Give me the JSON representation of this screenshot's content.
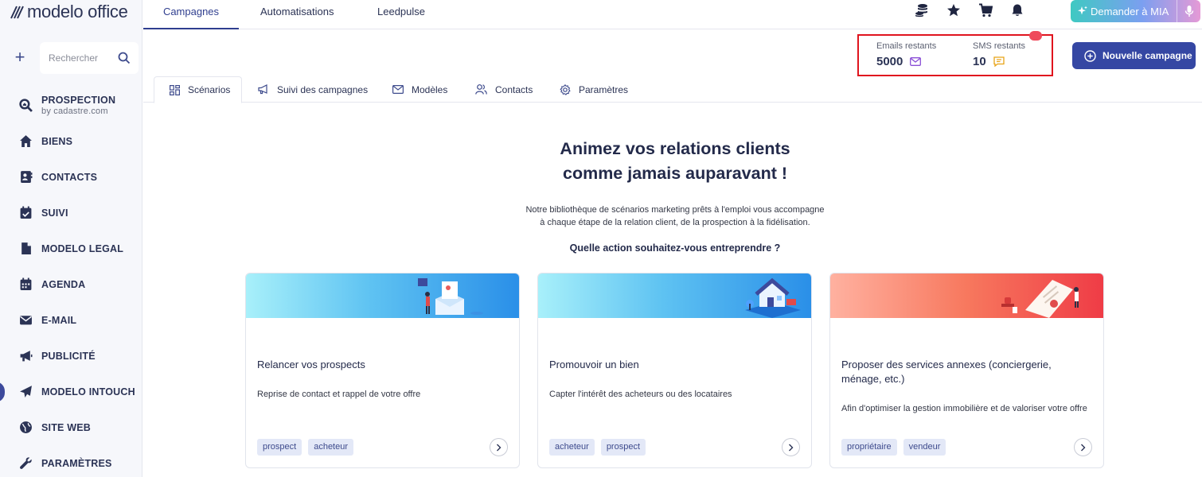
{
  "brand": {
    "logo_text": "modelo office"
  },
  "sidebar": {
    "search_placeholder": "Rechercher",
    "items": [
      {
        "label": "PROSPECTION",
        "sublabel": "by cadastre.com",
        "icon": "search-house-icon"
      },
      {
        "label": "BIENS",
        "icon": "house-icon"
      },
      {
        "label": "CONTACTS",
        "icon": "contact-card-icon"
      },
      {
        "label": "SUIVI",
        "icon": "calendar-check-icon"
      },
      {
        "label": "MODELO LEGAL",
        "icon": "document-icon"
      },
      {
        "label": "AGENDA",
        "icon": "calendar-icon"
      },
      {
        "label": "E-MAIL",
        "icon": "envelope-icon"
      },
      {
        "label": "PUBLICITÉ",
        "icon": "megaphone-icon"
      },
      {
        "label": "MODELO INTOUCH",
        "icon": "paper-plane-icon",
        "active": true
      },
      {
        "label": "SITE WEB",
        "icon": "globe-icon"
      },
      {
        "label": "PARAMÈTRES",
        "icon": "wrench-icon"
      }
    ]
  },
  "topbar": {
    "tabs": [
      "Campagnes",
      "Automatisations",
      "Leedpulse"
    ],
    "active_tab": "Campagnes",
    "mia_label": "Demander à MIA"
  },
  "credits": {
    "emails_label": "Emails restants",
    "emails_value": "5000",
    "sms_label": "SMS restants",
    "sms_value": "10"
  },
  "new_campaign_label": "Nouvelle campagne",
  "subtabs": [
    "Scénarios",
    "Suivi des campagnes",
    "Modèles",
    "Contacts",
    "Paramètres"
  ],
  "hero": {
    "title_line1": "Animez vos relations clients",
    "title_line2": "comme jamais auparavant !",
    "desc_line1": "Notre bibliothèque de scénarios marketing prêts à l'emploi vous accompagne",
    "desc_line2": "à chaque étape de la relation client, de la prospection à la fidélisation.",
    "question": "Quelle action souhaitez-vous entreprendre ?"
  },
  "cards": [
    {
      "title": "Relancer vos prospects",
      "desc": "Reprise de contact et rappel de votre offre",
      "tags": [
        "prospect",
        "acheteur"
      ]
    },
    {
      "title": "Promouvoir un bien",
      "desc": "Capter l'intérêt des acheteurs ou des locataires",
      "tags": [
        "acheteur",
        "prospect"
      ]
    },
    {
      "title": "Proposer des services annexes (conciergerie, ménage, etc.)",
      "desc": "Afin d'optimiser la gestion immobilière et de valoriser votre offre",
      "tags": [
        "propriétaire",
        "vendeur"
      ]
    }
  ],
  "colors": {
    "brand_navy": "#2b3355",
    "primary_button": "#3547a3",
    "highlight_box": "#e0141e"
  }
}
